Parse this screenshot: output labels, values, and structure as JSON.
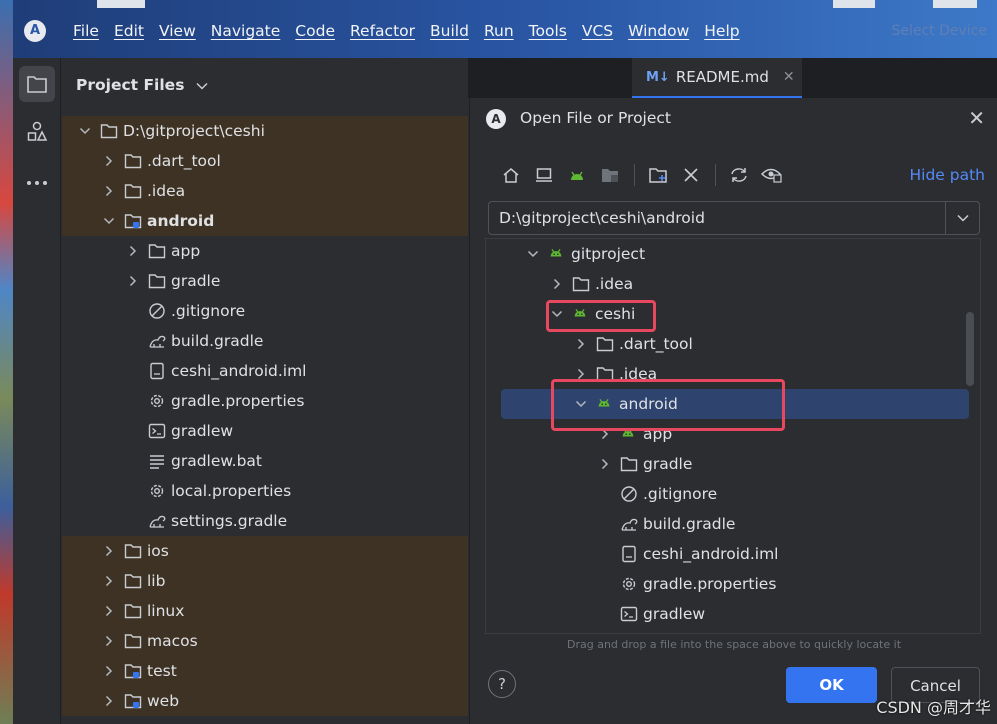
{
  "menu": [
    "File",
    "Edit",
    "View",
    "Navigate",
    "Code",
    "Refactor",
    "Build",
    "Run",
    "Tools",
    "VCS",
    "Window",
    "Help"
  ],
  "select_device": "Select Device",
  "app_logo": "A",
  "project_panel": {
    "title": "Project Files",
    "rows": [
      {
        "label": "D:\\gitproject\\ceshi",
        "depth": 0,
        "chevron": "down",
        "icon": "folder",
        "tinted": true,
        "bold": false
      },
      {
        "label": ".dart_tool",
        "depth": 1,
        "chevron": "right",
        "icon": "folder",
        "tinted": true,
        "bold": false
      },
      {
        "label": ".idea",
        "depth": 1,
        "chevron": "right",
        "icon": "folder",
        "tinted": true,
        "bold": false
      },
      {
        "label": "android",
        "depth": 1,
        "chevron": "down",
        "icon": "module-folder",
        "tinted": true,
        "bold": true
      },
      {
        "label": "app",
        "depth": 2,
        "chevron": "right",
        "icon": "folder",
        "tinted": false,
        "bold": false
      },
      {
        "label": "gradle",
        "depth": 2,
        "chevron": "right",
        "icon": "folder",
        "tinted": false,
        "bold": false
      },
      {
        "label": ".gitignore",
        "depth": 2,
        "chevron": "none",
        "icon": "ignore",
        "tinted": false,
        "bold": false
      },
      {
        "label": "build.gradle",
        "depth": 2,
        "chevron": "none",
        "icon": "gradle",
        "tinted": false,
        "bold": false
      },
      {
        "label": "ceshi_android.iml",
        "depth": 2,
        "chevron": "none",
        "icon": "file",
        "tinted": false,
        "bold": false
      },
      {
        "label": "gradle.properties",
        "depth": 2,
        "chevron": "none",
        "icon": "settings",
        "tinted": false,
        "bold": false
      },
      {
        "label": "gradlew",
        "depth": 2,
        "chevron": "none",
        "icon": "terminal",
        "tinted": false,
        "bold": false
      },
      {
        "label": "gradlew.bat",
        "depth": 2,
        "chevron": "none",
        "icon": "text",
        "tinted": false,
        "bold": false
      },
      {
        "label": "local.properties",
        "depth": 2,
        "chevron": "none",
        "icon": "settings",
        "tinted": false,
        "bold": false
      },
      {
        "label": "settings.gradle",
        "depth": 2,
        "chevron": "none",
        "icon": "gradle",
        "tinted": false,
        "bold": false
      },
      {
        "label": "ios",
        "depth": 1,
        "chevron": "right",
        "icon": "folder",
        "tinted": true,
        "bold": false
      },
      {
        "label": "lib",
        "depth": 1,
        "chevron": "right",
        "icon": "folder",
        "tinted": true,
        "bold": false
      },
      {
        "label": "linux",
        "depth": 1,
        "chevron": "right",
        "icon": "folder",
        "tinted": true,
        "bold": false
      },
      {
        "label": "macos",
        "depth": 1,
        "chevron": "right",
        "icon": "folder",
        "tinted": true,
        "bold": false
      },
      {
        "label": "test",
        "depth": 1,
        "chevron": "right",
        "icon": "module-folder",
        "tinted": true,
        "bold": false
      },
      {
        "label": "web",
        "depth": 1,
        "chevron": "right",
        "icon": "module-folder",
        "tinted": true,
        "bold": false
      }
    ]
  },
  "editor_tab": {
    "badge": "M↓",
    "label": "README.md"
  },
  "dialog": {
    "title": "Open File or Project",
    "hide_path": "Hide path",
    "path": "D:\\gitproject\\ceshi\\android",
    "hint": "Drag and drop a file into the space above to quickly locate it",
    "help": "?",
    "ok": "OK",
    "cancel": "Cancel",
    "tree": [
      {
        "label": "gitproject",
        "depth": 0,
        "chevron": "down",
        "icon": "android"
      },
      {
        "label": ".idea",
        "depth": 1,
        "chevron": "right",
        "icon": "folder"
      },
      {
        "label": "ceshi",
        "depth": 1,
        "chevron": "down",
        "icon": "android"
      },
      {
        "label": ".dart_tool",
        "depth": 2,
        "chevron": "right",
        "icon": "folder"
      },
      {
        "label": ".idea",
        "depth": 2,
        "chevron": "right",
        "icon": "folder"
      },
      {
        "label": "android",
        "depth": 2,
        "chevron": "down",
        "icon": "android",
        "selected": true
      },
      {
        "label": "app",
        "depth": 3,
        "chevron": "right",
        "icon": "android"
      },
      {
        "label": "gradle",
        "depth": 3,
        "chevron": "right",
        "icon": "folder"
      },
      {
        "label": ".gitignore",
        "depth": 3,
        "chevron": "none",
        "icon": "ignore"
      },
      {
        "label": "build.gradle",
        "depth": 3,
        "chevron": "none",
        "icon": "gradle"
      },
      {
        "label": "ceshi_android.iml",
        "depth": 3,
        "chevron": "none",
        "icon": "file"
      },
      {
        "label": "gradle.properties",
        "depth": 3,
        "chevron": "none",
        "icon": "settings"
      },
      {
        "label": "gradlew",
        "depth": 3,
        "chevron": "none",
        "icon": "terminal"
      }
    ]
  },
  "watermark": "CSDN @周才华",
  "colors": {
    "accent": "#3574f0",
    "highlight_box": "#e8485f",
    "android_green": "#5fb832",
    "selection": "#2e436e",
    "tinted_row": "#3d3223"
  }
}
